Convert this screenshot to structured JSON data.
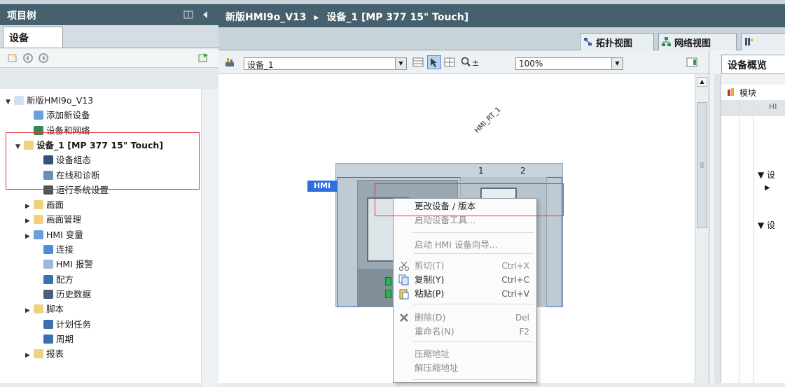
{
  "left_panel": {
    "title": "项目树",
    "tab": "设备",
    "tree": [
      {
        "label": "新版HMI9o_V13",
        "arrow": "▼",
        "icon": "project-icon",
        "bold": false
      },
      {
        "label": "添加新设备",
        "arrow": "",
        "icon": "add-device-icon",
        "bold": false
      },
      {
        "label": "设备和网络",
        "arrow": "",
        "icon": "network-icon",
        "bold": false
      },
      {
        "label": "设备_1 [MP 377 15\" Touch]",
        "arrow": "▼",
        "icon": "folder-icon",
        "bold": true
      },
      {
        "label": "设备组态",
        "arrow": "",
        "icon": "device-config-icon",
        "bold": false
      },
      {
        "label": "在线和诊断",
        "arrow": "",
        "icon": "diagnostics-icon",
        "bold": false
      },
      {
        "label": "运行系统设置",
        "arrow": "",
        "icon": "runtime-settings-icon",
        "bold": false
      },
      {
        "label": "画面",
        "arrow": "▶",
        "icon": "folder-icon",
        "bold": false
      },
      {
        "label": "画面管理",
        "arrow": "▶",
        "icon": "screen-management-icon",
        "bold": false
      },
      {
        "label": "HMI 变量",
        "arrow": "▶",
        "icon": "tags-icon",
        "bold": false
      },
      {
        "label": "连接",
        "arrow": "",
        "icon": "connection-icon",
        "bold": false
      },
      {
        "label": "HMI 报警",
        "arrow": "",
        "icon": "alarm-icon",
        "bold": false
      },
      {
        "label": "配方",
        "arrow": "",
        "icon": "recipe-icon",
        "bold": false
      },
      {
        "label": "历史数据",
        "arrow": "",
        "icon": "history-icon",
        "bold": false
      },
      {
        "label": "脚本",
        "arrow": "▶",
        "icon": "script-icon",
        "bold": false
      },
      {
        "label": "计划任务",
        "arrow": "",
        "icon": "scheduler-icon",
        "bold": false
      },
      {
        "label": "周期",
        "arrow": "",
        "icon": "cycle-icon",
        "bold": false
      },
      {
        "label": "报表",
        "arrow": "▶",
        "icon": "report-icon",
        "bold": false
      }
    ]
  },
  "editor": {
    "breadcrumb_project": "新版HMI9o_V13",
    "breadcrumb_sep": "▸",
    "breadcrumb_device": "设备_1 [MP 377 15\" Touch]",
    "view_tabs": [
      "拓扑视图",
      "网络视图"
    ],
    "device_combo": "设备_1",
    "zoom": "100%",
    "device_name_label": "HMI_RT_1",
    "slot_numbers": [
      "1",
      "2"
    ],
    "hmi_badge": "HMI"
  },
  "overview": {
    "tab": "设备概览",
    "header": "模块",
    "subheader": "HI",
    "rows": [
      "▼ 设",
      "▶",
      "▼ 设"
    ]
  },
  "context_menu": {
    "items": [
      {
        "label": "更改设备 / 版本",
        "shortcut": "",
        "disabled": false,
        "icon": ""
      },
      {
        "label": "启动设备工具...",
        "shortcut": "",
        "disabled": true,
        "icon": ""
      },
      {
        "label": "启动 HMI 设备向导...",
        "shortcut": "",
        "disabled": true,
        "icon": ""
      },
      {
        "label": "剪切(T)",
        "shortcut": "Ctrl+X",
        "disabled": true,
        "icon": "cut-icon"
      },
      {
        "label": "复制(Y)",
        "shortcut": "Ctrl+C",
        "disabled": false,
        "icon": "copy-icon"
      },
      {
        "label": "粘贴(P)",
        "shortcut": "Ctrl+V",
        "disabled": false,
        "icon": "paste-icon"
      },
      {
        "label": "删除(D)",
        "shortcut": "Del",
        "disabled": true,
        "icon": "delete-icon"
      },
      {
        "label": "重命名(N)",
        "shortcut": "F2",
        "disabled": true,
        "icon": ""
      },
      {
        "label": "压缩地址",
        "shortcut": "",
        "disabled": true,
        "icon": ""
      },
      {
        "label": "解压缩地址",
        "shortcut": "",
        "disabled": true,
        "icon": ""
      }
    ]
  },
  "colors": {
    "title_bar": "#47606e",
    "highlight": "#e0393e",
    "hmi_blue": "#2f6fdb",
    "port_green": "#25b34a"
  }
}
